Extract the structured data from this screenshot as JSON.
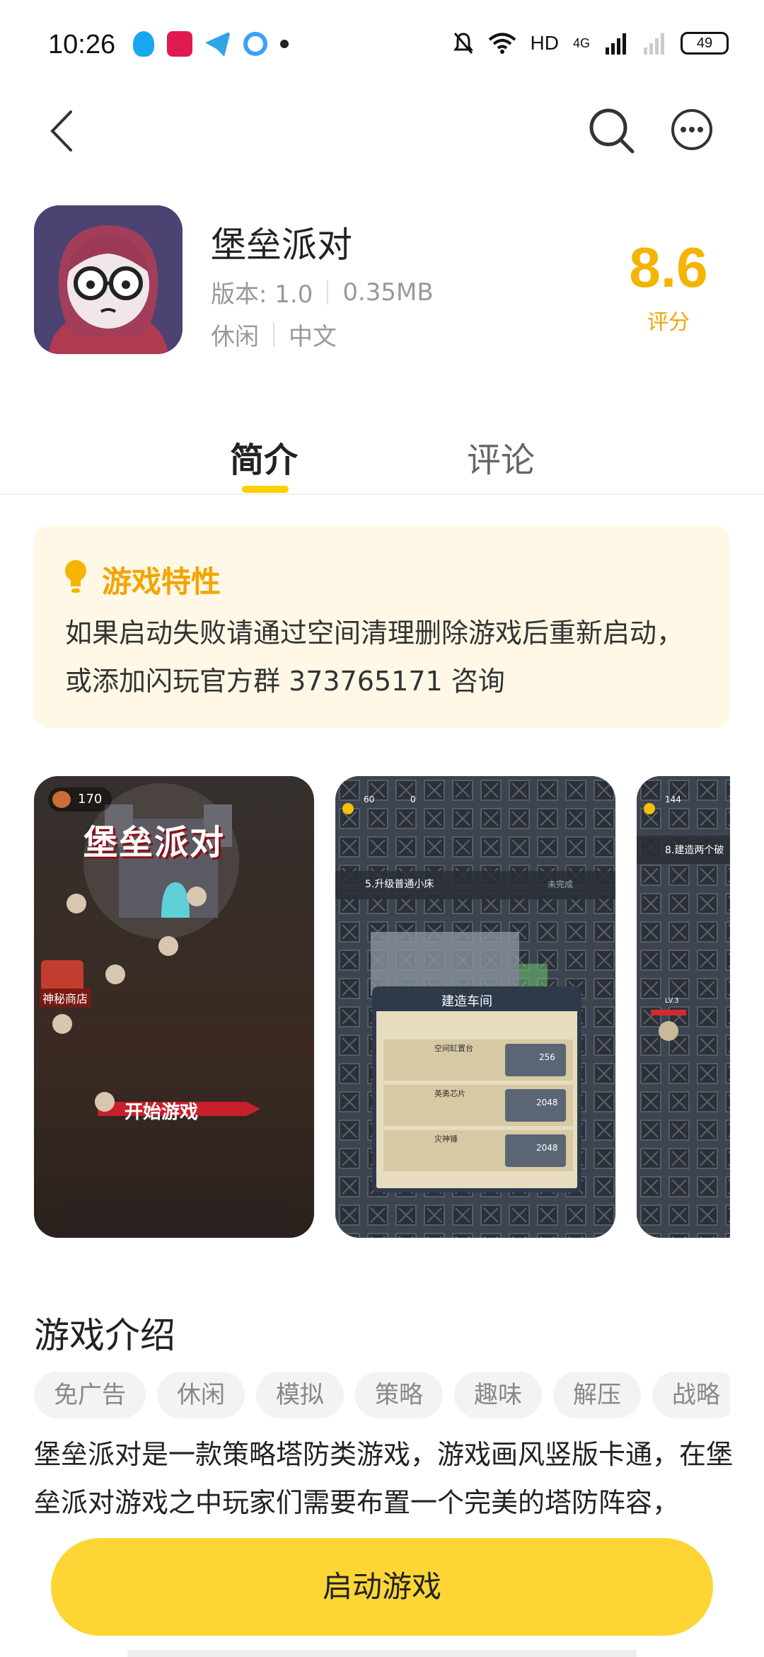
{
  "status_bar": {
    "time": "10:26",
    "network_label": "HD",
    "signal_label": "4G",
    "battery": "49",
    "icons": [
      "qq-icon",
      "tiktok-icon",
      "telegram-icon",
      "qq-browser-icon",
      "mute-icon",
      "wifi-icon",
      "signal-icon"
    ]
  },
  "nav": {
    "icons": [
      "back-icon",
      "search-icon",
      "more-icon"
    ]
  },
  "app": {
    "name": "堡垒派对",
    "version": "版本: 1.0",
    "size": "0.35MB",
    "category": "休闲",
    "language": "中文",
    "rating": "8.6",
    "rating_label": "评分"
  },
  "tabs": {
    "intro": "简介",
    "comments": "评论"
  },
  "features": {
    "title": "游戏特性",
    "text": "如果启动失败请通过空间清理删除游戏后重新启动，或添加闪玩官方群  373765171  咨询"
  },
  "screenshots": {
    "shot1": {
      "coins": "170",
      "title": "堡垒派对",
      "start": "开始游戏",
      "shop": "神秘商店"
    },
    "shot2": {
      "coins": "60",
      "energy": "0",
      "task": "5.升级普通小床",
      "status": "未完成",
      "panel_title": "建造车间",
      "items": [
        {
          "name": "空间缸置台",
          "cost": "256"
        },
        {
          "name": "英勇芯片",
          "cost": "2048"
        },
        {
          "name": "灾神锤",
          "cost": "2048"
        }
      ]
    },
    "shot3": {
      "coins": "144",
      "task": "8.建造两个破",
      "level": "LV.3"
    }
  },
  "intro": {
    "title": "游戏介绍",
    "tags": [
      "免广告",
      "休闲",
      "模拟",
      "策略",
      "趣味",
      "解压",
      "战略"
    ],
    "description": "堡垒派对是一款策略塔防类游戏，游戏画风竖版卡通，在堡垒派对游戏之中玩家们需要布置一个完美的塔防阵容，"
  },
  "launch_button": "启动游戏",
  "colors": {
    "accent": "#fdd636",
    "rating": "#f5b400",
    "feature_bg": "#fff8e6"
  }
}
